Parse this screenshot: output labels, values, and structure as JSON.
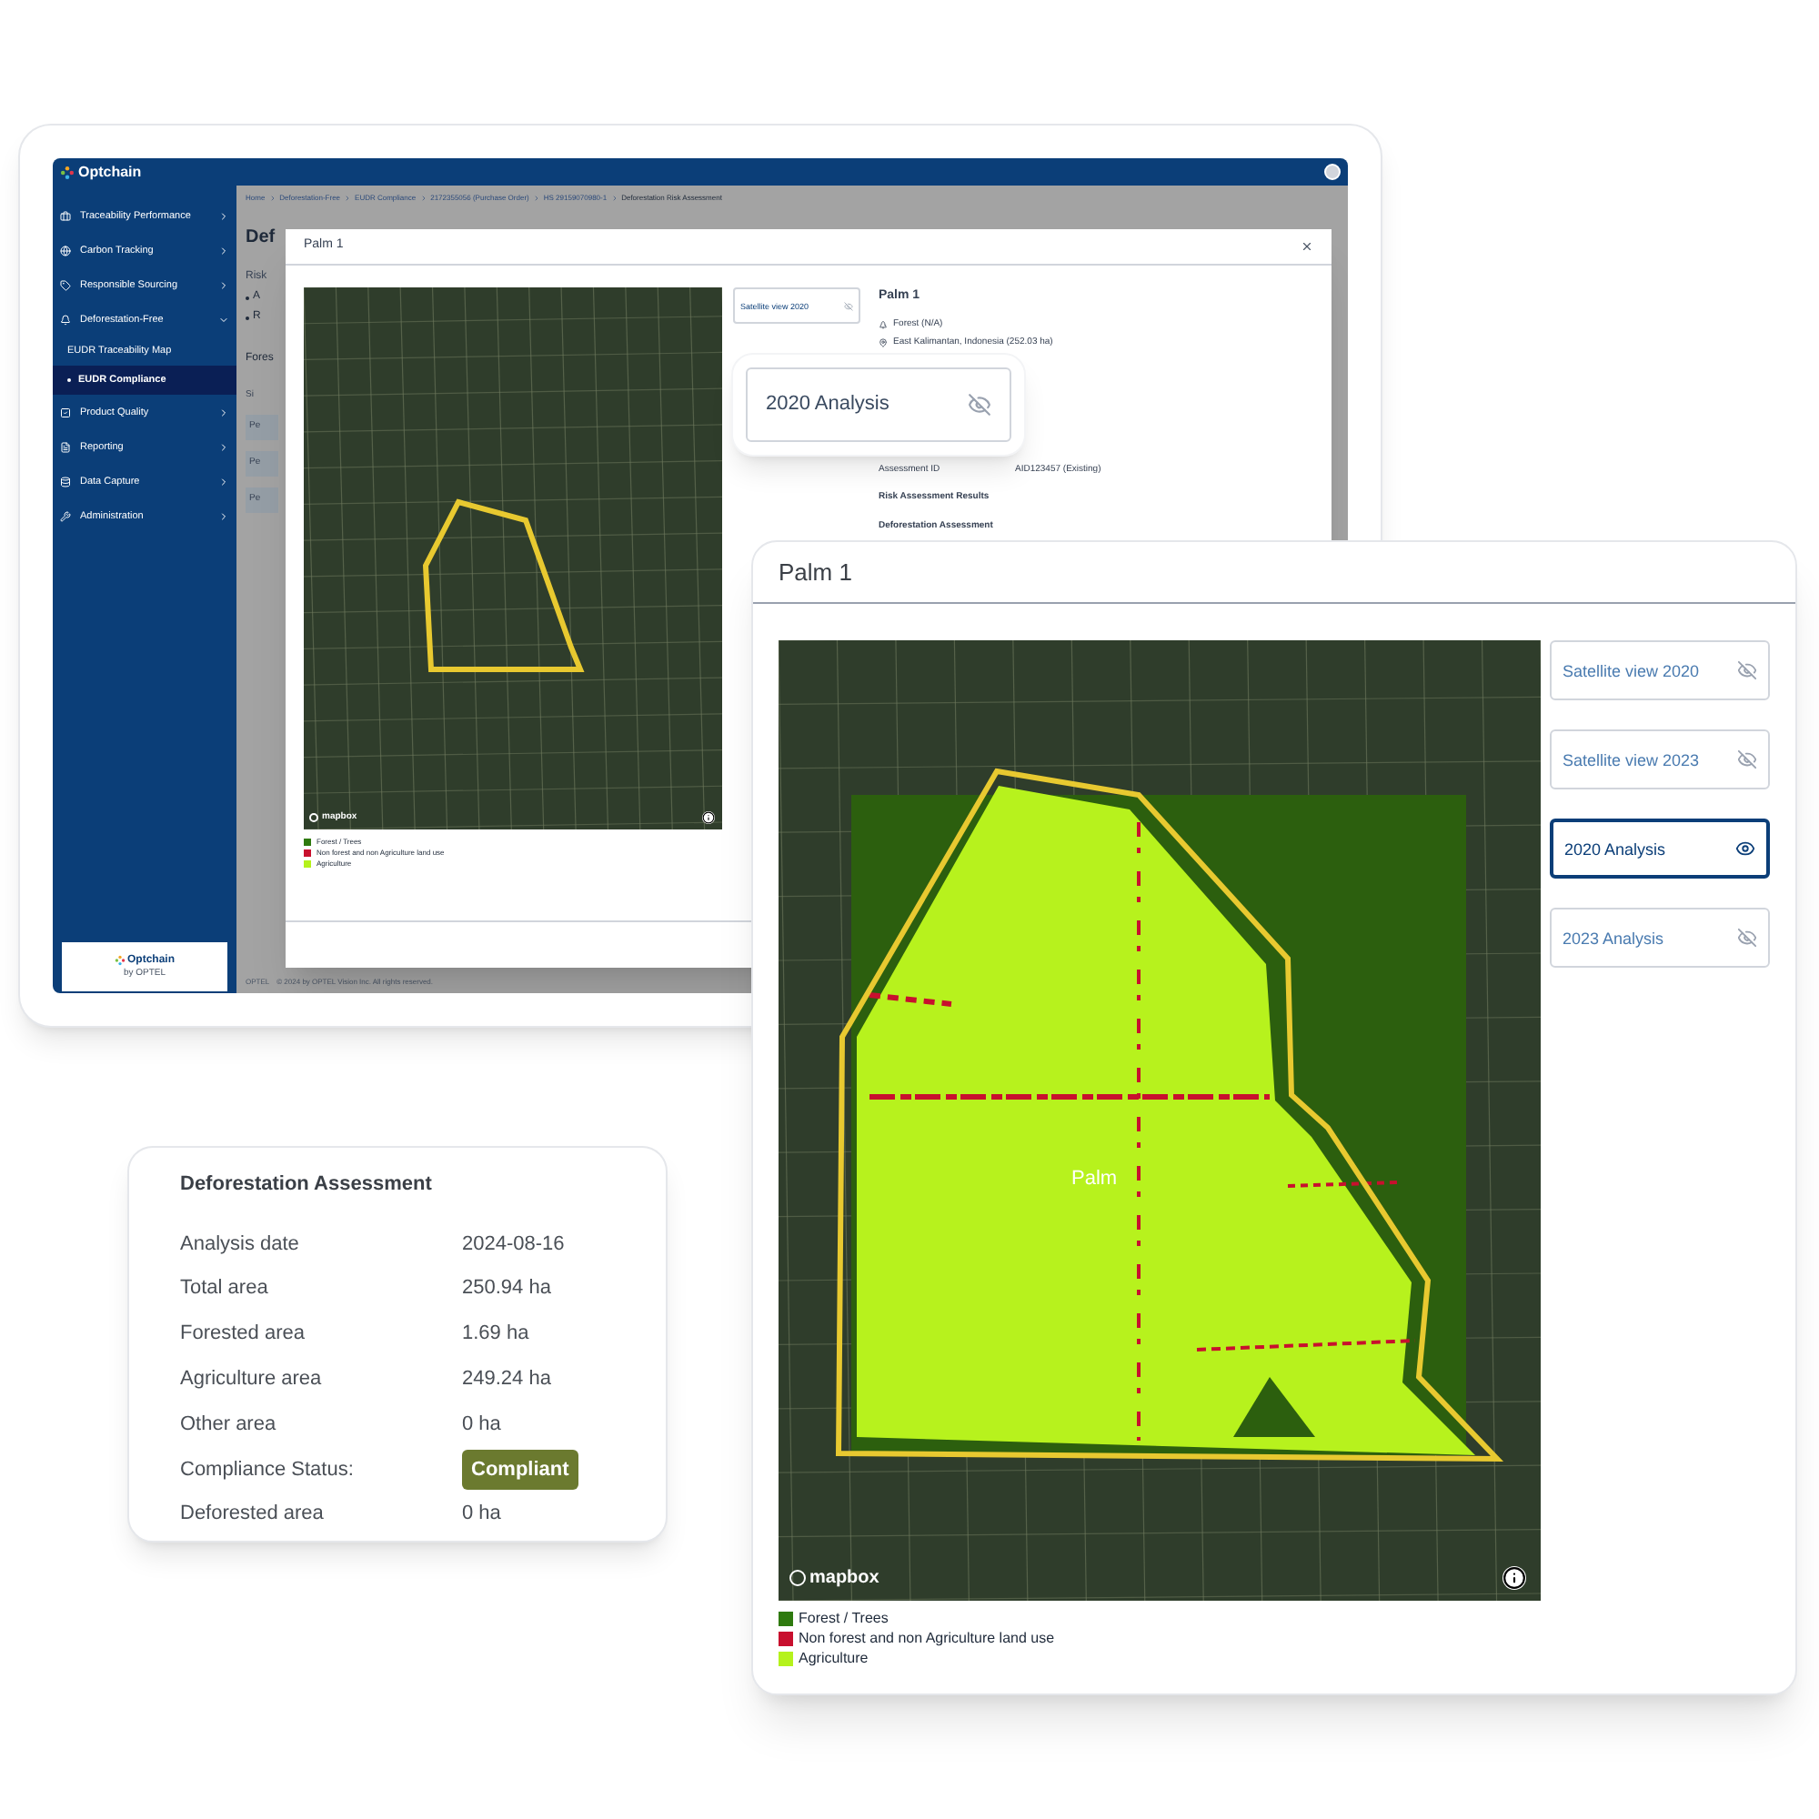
{
  "app": {
    "logo": "Optchain",
    "sidebar": {
      "items": [
        {
          "label": "Traceability Performance",
          "expanded": false
        },
        {
          "label": "Carbon Tracking",
          "expanded": false
        },
        {
          "label": "Responsible Sourcing",
          "expanded": false
        },
        {
          "label": "Deforestation-Free",
          "expanded": true,
          "children": [
            {
              "label": "EUDR Traceability Map",
              "selected": false
            },
            {
              "label": "EUDR Compliance",
              "selected": true
            }
          ]
        },
        {
          "label": "Product Quality",
          "expanded": false
        },
        {
          "label": "Reporting",
          "expanded": false
        },
        {
          "label": "Data Capture",
          "expanded": false
        },
        {
          "label": "Administration",
          "expanded": false
        }
      ],
      "footer_logo": "Optchain",
      "footer_logo_sub": "by OPTEL"
    },
    "breadcrumb": [
      "Home",
      "Deforestation-Free",
      "EUDR Compliance",
      "2172355056 (Purchase Order)",
      "HS 29159070980-1",
      "Deforestation Risk Assessment"
    ],
    "page": {
      "heading": "Def",
      "risk_label": "Risk",
      "bullets": [
        "A",
        "R"
      ],
      "section": "Fores",
      "table_header": "Si",
      "rows": [
        "Pe",
        "Pe",
        "Pe"
      ]
    },
    "footer": {
      "logo": "OPTEL",
      "text": "© 2024 by OPTEL Vision Inc. All rights reserved."
    },
    "modal": {
      "title": "Palm 1",
      "mapbox": "mapbox",
      "toggles": [
        {
          "label": "Satellite view 2020",
          "selected": false
        }
      ],
      "legend": [
        {
          "label": "Forest / Trees",
          "color": "#2f7a0f"
        },
        {
          "label": "Non forest and non Agriculture land use",
          "color": "#c8102e"
        },
        {
          "label": "Agriculture",
          "color": "#b5f21c"
        }
      ],
      "details": {
        "name": "Palm 1",
        "land": "Forest (N/A)",
        "location": "East Kalimantan, Indonesia (252.03 ha)",
        "fields": [
          {
            "label": "Assessment ID",
            "value": "AID123457 (Existing)"
          }
        ],
        "sections": [
          "Risk Assessment Results",
          "Deforestation Assessment"
        ]
      }
    }
  },
  "callout": {
    "label": "2020 Analysis",
    "selected": false
  },
  "assessment": {
    "title": "Deforestation Assessment",
    "rows": [
      {
        "label": "Analysis date",
        "value": "2024-08-16",
        "kind": "text"
      },
      {
        "label": "Total area",
        "value": "250.94 ha",
        "kind": "text"
      },
      {
        "label": "Forested area",
        "value": "1.69 ha",
        "kind": "text"
      },
      {
        "label": "Agriculture area",
        "value": "249.24 ha",
        "kind": "text"
      },
      {
        "label": "Other area",
        "value": "0 ha",
        "kind": "text"
      },
      {
        "label": "Compliance Status:",
        "value": "Compliant",
        "kind": "badge"
      },
      {
        "label": "Deforested area",
        "value": "0 ha",
        "kind": "text"
      }
    ]
  },
  "detail_panel": {
    "title": "Palm 1",
    "map_label": "Palm",
    "mapbox": "mapbox",
    "toggles": [
      {
        "label": "Satellite view 2020",
        "selected": false
      },
      {
        "label": "Satellite view 2023",
        "selected": false
      },
      {
        "label": "2020 Analysis",
        "selected": true
      },
      {
        "label": "2023 Analysis",
        "selected": false
      }
    ],
    "legend": [
      {
        "label": "Forest / Trees",
        "color": "#2f7a0f"
      },
      {
        "label": "Non forest and non Agriculture land use",
        "color": "#c8102e"
      },
      {
        "label": "Agriculture",
        "color": "#b5f21c"
      }
    ]
  }
}
